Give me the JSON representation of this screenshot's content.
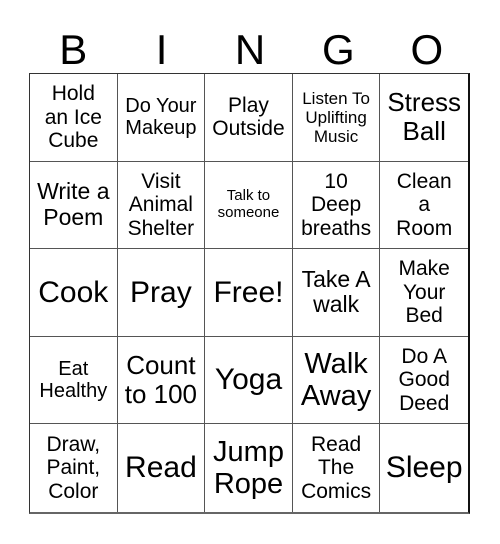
{
  "header": {
    "letters": [
      "B",
      "I",
      "N",
      "G",
      "O"
    ]
  },
  "cells": [
    "Hold an Ice Cube",
    "Do Your Makeup",
    "Play Outside",
    "Listen To Uplifting Music",
    "Stress Ball",
    "Write a Poem",
    "Visit Animal Shelter",
    "Talk to someone",
    "10 Deep breaths",
    "Clean a Room",
    "Cook",
    "Pray",
    "Free!",
    "Take A walk",
    "Make Your Bed",
    "Eat Healthy",
    "Count to 100",
    "Yoga",
    "Walk Away",
    "Do A Good Deed",
    "Draw, Paint, Color",
    "Read",
    "Jump Rope",
    "Read The Comics",
    "Sleep"
  ],
  "cell_lines": [
    [
      "Hold",
      "an Ice",
      "Cube"
    ],
    [
      "Do Your",
      "Makeup"
    ],
    [
      "Play",
      "Outside"
    ],
    [
      "Listen To",
      "Uplifting",
      "Music"
    ],
    [
      "Stress",
      "Ball"
    ],
    [
      "Write a",
      "Poem"
    ],
    [
      "Visit",
      "Animal",
      "Shelter"
    ],
    [
      "Talk to",
      "someone"
    ],
    [
      "10",
      "Deep",
      "breaths"
    ],
    [
      "Clean",
      "a",
      "Room"
    ],
    [
      "Cook"
    ],
    [
      "Pray"
    ],
    [
      "Free!"
    ],
    [
      "Take A",
      "walk"
    ],
    [
      "Make",
      "Your",
      "Bed"
    ],
    [
      "Eat",
      "Healthy"
    ],
    [
      "Count",
      "to 100"
    ],
    [
      "Yoga"
    ],
    [
      "Walk",
      "Away"
    ],
    [
      "Do A",
      "Good",
      "Deed"
    ],
    [
      "Draw,",
      "Paint,",
      "Color"
    ],
    [
      "Read"
    ],
    [
      "Jump",
      "Rope"
    ],
    [
      "Read",
      "The",
      "Comics"
    ],
    [
      "Sleep"
    ]
  ]
}
